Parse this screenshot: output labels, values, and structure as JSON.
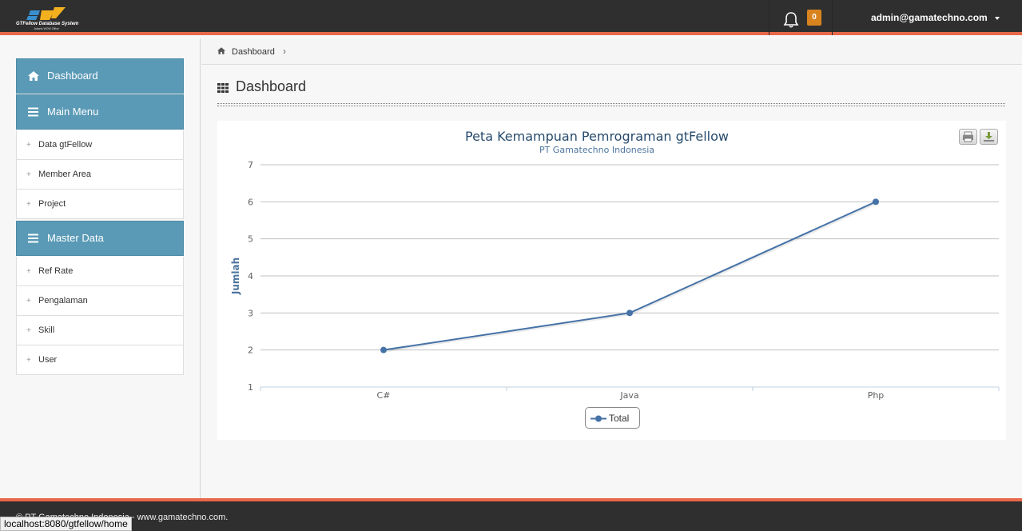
{
  "header": {
    "logo_title": "GTFellow Database System",
    "logo_subtitle": "Jakarta WOW Office",
    "notification_count": "0",
    "user_email": "admin@gamatechno.com"
  },
  "sidebar": {
    "dashboard_label": "Dashboard",
    "main_menu_label": "Main Menu",
    "main_menu_items": [
      "Data gtFellow",
      "Member Area",
      "Project"
    ],
    "master_data_label": "Master Data",
    "master_data_items": [
      "Ref Rate",
      "Pengalaman",
      "Skill",
      "User"
    ]
  },
  "breadcrumb": {
    "items": [
      "Dashboard"
    ]
  },
  "page": {
    "title": "Dashboard"
  },
  "chart_data": {
    "type": "line",
    "title": "Peta Kemampuan Pemrograman gtFellow",
    "subtitle": "PT Gamatechno Indonesia",
    "xlabel": "",
    "ylabel": "Jumlah",
    "categories": [
      "C#",
      "Java",
      "Php"
    ],
    "series": [
      {
        "name": "Total",
        "values": [
          2,
          3,
          6
        ]
      }
    ],
    "ylim": [
      1,
      7
    ],
    "yticks": [
      1,
      2,
      3,
      4,
      5,
      6,
      7
    ],
    "grid": true,
    "legend": "bottom-center",
    "color": "#4572a7"
  },
  "footer": {
    "text": "© PT Gamatechno Indonesia - www.gamatechno.com."
  },
  "status_bar": {
    "url": "localhost:8080/gtfellow/home"
  }
}
